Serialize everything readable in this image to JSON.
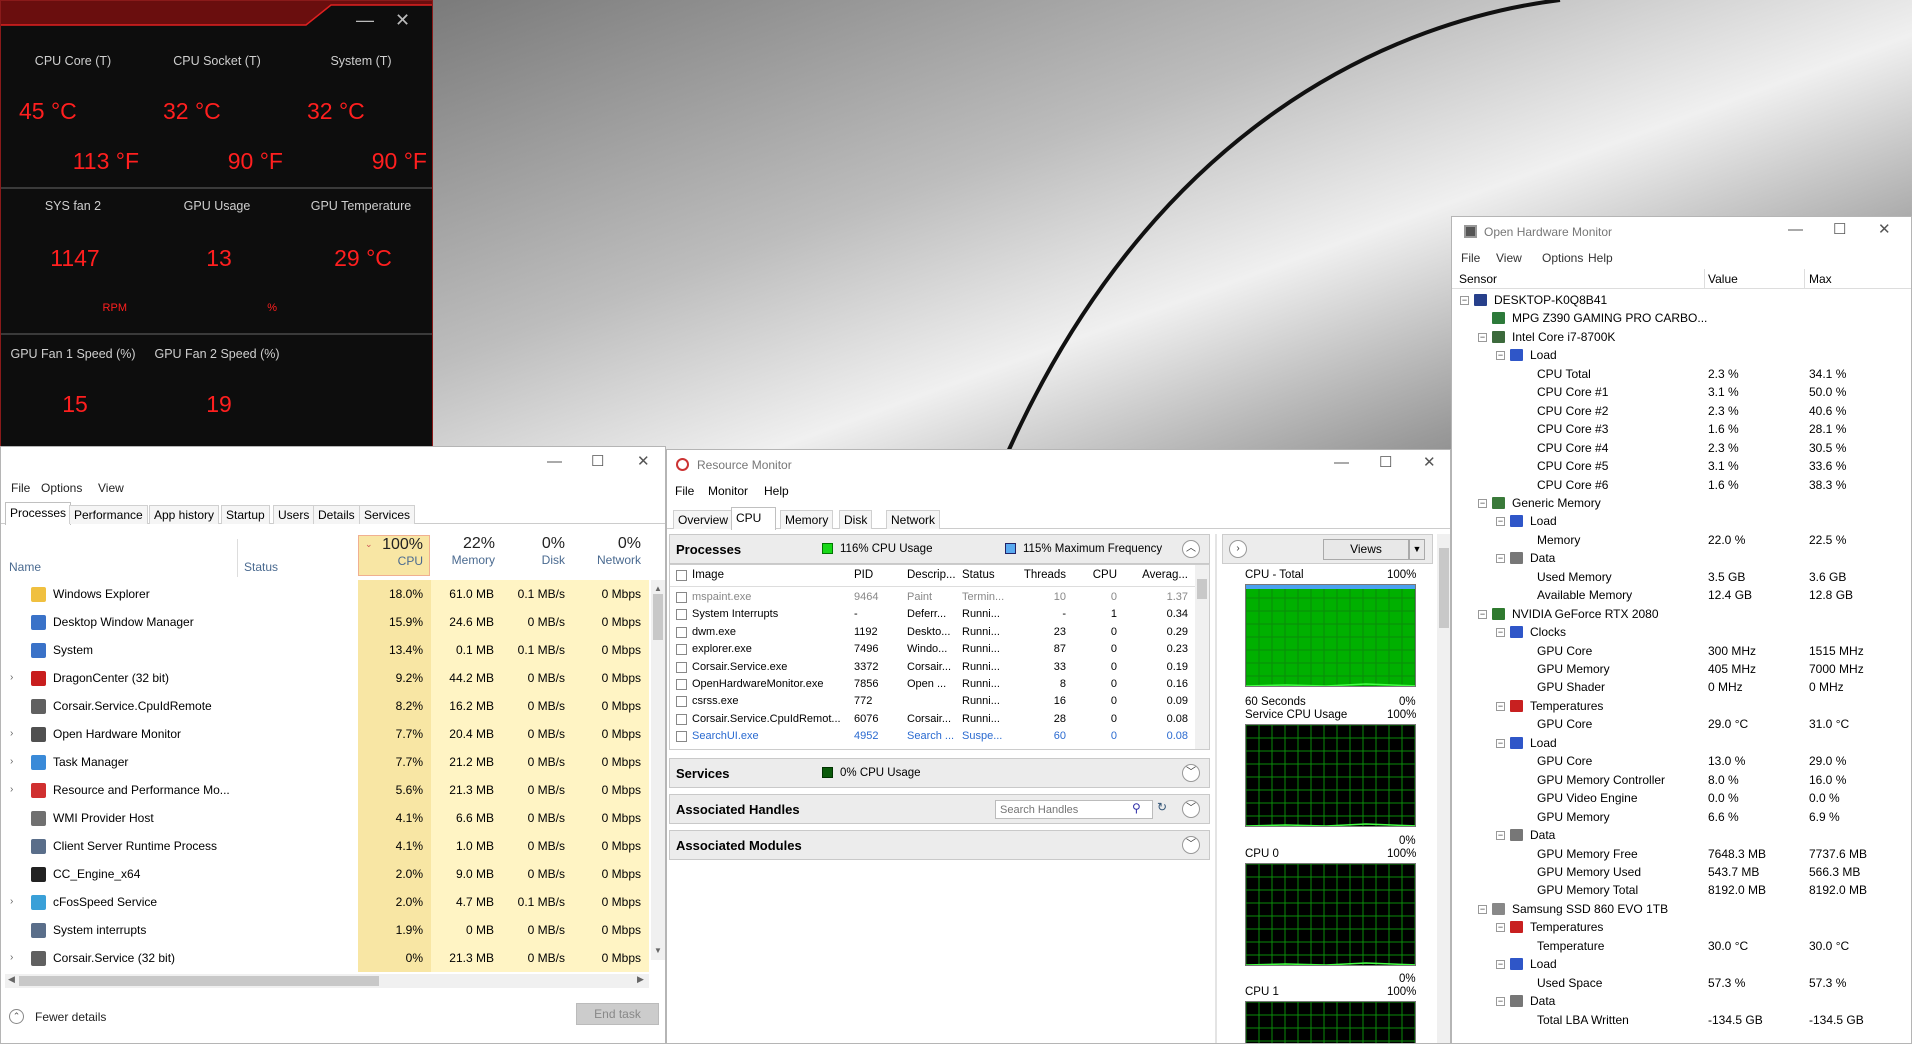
{
  "dragon": {
    "tiles": [
      {
        "label": "CPU Core (T)",
        "c": "45 °C",
        "f": "113 °F"
      },
      {
        "label": "CPU Socket (T)",
        "c": "32 °C",
        "f": "90 °F"
      },
      {
        "label": "System (T)",
        "c": "32 °C",
        "f": "90 °F"
      }
    ],
    "tiles2": [
      {
        "label": "SYS fan 2",
        "value": "1147",
        "unit": "RPM"
      },
      {
        "label": "GPU Usage",
        "value": "13",
        "unit": "%"
      },
      {
        "label": "GPU Temperature",
        "value": "29 °C",
        "unit": ""
      }
    ],
    "tiles3": [
      {
        "label": "GPU Fan 1 Speed (%)",
        "value": "15",
        "unit": "%"
      },
      {
        "label": "GPU Fan 2 Speed (%)",
        "value": "19",
        "unit": "%"
      }
    ]
  },
  "taskmgr": {
    "menu": [
      "File",
      "Options",
      "View"
    ],
    "tabs": [
      "Processes",
      "Performance",
      "App history",
      "Startup",
      "Users",
      "Details",
      "Services"
    ],
    "cols": {
      "name": "Name",
      "status": "Status",
      "cpu_pct": "100%",
      "cpu": "CPU",
      "mem_pct": "22%",
      "mem": "Memory",
      "disk_pct": "0%",
      "disk": "Disk",
      "net_pct": "0%",
      "net": "Network"
    },
    "rows": [
      {
        "name": "Windows Explorer",
        "cpu": "18.0%",
        "mem": "61.0 MB",
        "disk": "0.1 MB/s",
        "net": "0 Mbps",
        "exp": ""
      },
      {
        "name": "Desktop Window Manager",
        "cpu": "15.9%",
        "mem": "24.6 MB",
        "disk": "0 MB/s",
        "net": "0 Mbps",
        "exp": ""
      },
      {
        "name": "System",
        "cpu": "13.4%",
        "mem": "0.1 MB",
        "disk": "0.1 MB/s",
        "net": "0 Mbps",
        "exp": ""
      },
      {
        "name": "DragonCenter (32 bit)",
        "cpu": "9.2%",
        "mem": "44.2 MB",
        "disk": "0 MB/s",
        "net": "0 Mbps",
        "exp": ">"
      },
      {
        "name": "Corsair.Service.CpuIdRemote",
        "cpu": "8.2%",
        "mem": "16.2 MB",
        "disk": "0 MB/s",
        "net": "0 Mbps",
        "exp": ""
      },
      {
        "name": "Open Hardware Monitor",
        "cpu": "7.7%",
        "mem": "20.4 MB",
        "disk": "0 MB/s",
        "net": "0 Mbps",
        "exp": ">"
      },
      {
        "name": "Task Manager",
        "cpu": "7.7%",
        "mem": "21.2 MB",
        "disk": "0 MB/s",
        "net": "0 Mbps",
        "exp": ">"
      },
      {
        "name": "Resource and Performance Mo...",
        "cpu": "5.6%",
        "mem": "21.3 MB",
        "disk": "0 MB/s",
        "net": "0 Mbps",
        "exp": ">"
      },
      {
        "name": "WMI Provider Host",
        "cpu": "4.1%",
        "mem": "6.6 MB",
        "disk": "0 MB/s",
        "net": "0 Mbps",
        "exp": ""
      },
      {
        "name": "Client Server Runtime Process",
        "cpu": "4.1%",
        "mem": "1.0 MB",
        "disk": "0 MB/s",
        "net": "0 Mbps",
        "exp": ""
      },
      {
        "name": "CC_Engine_x64",
        "cpu": "2.0%",
        "mem": "9.0 MB",
        "disk": "0 MB/s",
        "net": "0 Mbps",
        "exp": ""
      },
      {
        "name": "cFosSpeed Service",
        "cpu": "2.0%",
        "mem": "4.7 MB",
        "disk": "0.1 MB/s",
        "net": "0 Mbps",
        "exp": ">"
      },
      {
        "name": "System interrupts",
        "cpu": "1.9%",
        "mem": "0 MB",
        "disk": "0 MB/s",
        "net": "0 Mbps",
        "exp": ""
      },
      {
        "name": "Corsair.Service (32 bit)",
        "cpu": "0%",
        "mem": "21.3 MB",
        "disk": "0 MB/s",
        "net": "0 Mbps",
        "exp": ">"
      }
    ],
    "fewer": "Fewer details",
    "end": "End task"
  },
  "resmon": {
    "title": "Resource Monitor",
    "menu": [
      "File",
      "Monitor",
      "Help"
    ],
    "tabs": [
      "Overview",
      "CPU",
      "Memory",
      "Disk",
      "Network"
    ],
    "processes": "Processes",
    "cpu_usage": "116% CPU Usage",
    "max_freq": "115% Maximum Frequency",
    "cols": [
      "Image",
      "PID",
      "Descrip...",
      "Status",
      "Threads",
      "CPU",
      "Averag..."
    ],
    "rows": [
      [
        "mspaint.exe",
        "9464",
        "Paint",
        "Termin...",
        "10",
        "0",
        "1.37"
      ],
      [
        "System Interrupts",
        "-",
        "Deferr...",
        "Runni...",
        "-",
        "1",
        "0.34"
      ],
      [
        "dwm.exe",
        "1192",
        "Deskto...",
        "Runni...",
        "23",
        "0",
        "0.29"
      ],
      [
        "explorer.exe",
        "7496",
        "Windo...",
        "Runni...",
        "87",
        "0",
        "0.23"
      ],
      [
        "Corsair.Service.exe",
        "3372",
        "Corsair...",
        "Runni...",
        "33",
        "0",
        "0.19"
      ],
      [
        "OpenHardwareMonitor.exe",
        "7856",
        "Open ...",
        "Runni...",
        "8",
        "0",
        "0.16"
      ],
      [
        "csrss.exe",
        "772",
        "",
        "Runni...",
        "16",
        "0",
        "0.09"
      ],
      [
        "Corsair.Service.CpuIdRemot...",
        "6076",
        "Corsair...",
        "Runni...",
        "28",
        "0",
        "0.08"
      ],
      [
        "SearchUI.exe",
        "4952",
        "Search ...",
        "Suspe...",
        "60",
        "0",
        "0.08"
      ]
    ],
    "services": "Services",
    "services_usage": "0% CPU Usage",
    "handles": "Associated Handles",
    "search_placeholder": "Search Handles",
    "modules": "Associated Modules",
    "views": "Views",
    "graphs": [
      {
        "label": "CPU - Total",
        "max": "100%",
        "min": "",
        "foot": ""
      },
      {
        "label": "Service CPU Usage",
        "max": "100%",
        "min": "0%",
        "foot": "60 Seconds"
      },
      {
        "label": "CPU 0",
        "max": "100%",
        "min": "0%",
        "foot": ""
      },
      {
        "label": "CPU 1",
        "max": "100%",
        "min": "0%",
        "foot": ""
      }
    ]
  },
  "ohm": {
    "title": "Open Hardware Monitor",
    "menu": [
      "File",
      "View",
      "Options",
      "Help"
    ],
    "cols": [
      "Sensor",
      "Value",
      "Max"
    ],
    "rows": [
      {
        "n": "DESKTOP-K0Q8B41",
        "v": "",
        "m": "",
        "lvl": 0,
        "t": "-",
        "ic": "pc"
      },
      {
        "n": "MPG Z390 GAMING PRO CARBO...",
        "v": "",
        "m": "",
        "lvl": 1,
        "t": "",
        "ic": "mb"
      },
      {
        "n": "Intel Core i7-8700K",
        "v": "",
        "m": "",
        "lvl": 1,
        "t": "-",
        "ic": "cpu"
      },
      {
        "n": "Load",
        "v": "",
        "m": "",
        "lvl": 2,
        "t": "-",
        "ic": "load"
      },
      {
        "n": "CPU Total",
        "v": "2.3 %",
        "m": "34.1 %",
        "lvl": 3,
        "t": "",
        "ic": ""
      },
      {
        "n": "CPU Core #1",
        "v": "3.1 %",
        "m": "50.0 %",
        "lvl": 3,
        "t": "",
        "ic": ""
      },
      {
        "n": "CPU Core #2",
        "v": "2.3 %",
        "m": "40.6 %",
        "lvl": 3,
        "t": "",
        "ic": ""
      },
      {
        "n": "CPU Core #3",
        "v": "1.6 %",
        "m": "28.1 %",
        "lvl": 3,
        "t": "",
        "ic": ""
      },
      {
        "n": "CPU Core #4",
        "v": "2.3 %",
        "m": "30.5 %",
        "lvl": 3,
        "t": "",
        "ic": ""
      },
      {
        "n": "CPU Core #5",
        "v": "3.1 %",
        "m": "33.6 %",
        "lvl": 3,
        "t": "",
        "ic": ""
      },
      {
        "n": "CPU Core #6",
        "v": "1.6 %",
        "m": "38.3 %",
        "lvl": 3,
        "t": "",
        "ic": ""
      },
      {
        "n": "Generic Memory",
        "v": "",
        "m": "",
        "lvl": 1,
        "t": "-",
        "ic": "mem"
      },
      {
        "n": "Load",
        "v": "",
        "m": "",
        "lvl": 2,
        "t": "-",
        "ic": "load"
      },
      {
        "n": "Memory",
        "v": "22.0 %",
        "m": "22.5 %",
        "lvl": 3,
        "t": "",
        "ic": ""
      },
      {
        "n": "Data",
        "v": "",
        "m": "",
        "lvl": 2,
        "t": "-",
        "ic": "data"
      },
      {
        "n": "Used Memory",
        "v": "3.5 GB",
        "m": "3.6 GB",
        "lvl": 3,
        "t": "",
        "ic": ""
      },
      {
        "n": "Available Memory",
        "v": "12.4 GB",
        "m": "12.8 GB",
        "lvl": 3,
        "t": "",
        "ic": ""
      },
      {
        "n": "NVIDIA GeForce RTX 2080",
        "v": "",
        "m": "",
        "lvl": 1,
        "t": "-",
        "ic": "gpu"
      },
      {
        "n": "Clocks",
        "v": "",
        "m": "",
        "lvl": 2,
        "t": "-",
        "ic": "clock"
      },
      {
        "n": "GPU Core",
        "v": "300 MHz",
        "m": "1515 MHz",
        "lvl": 3,
        "t": "",
        "ic": ""
      },
      {
        "n": "GPU Memory",
        "v": "405 MHz",
        "m": "7000 MHz",
        "lvl": 3,
        "t": "",
        "ic": ""
      },
      {
        "n": "GPU Shader",
        "v": "0 MHz",
        "m": "0 MHz",
        "lvl": 3,
        "t": "",
        "ic": ""
      },
      {
        "n": "Temperatures",
        "v": "",
        "m": "",
        "lvl": 2,
        "t": "-",
        "ic": "temp"
      },
      {
        "n": "GPU Core",
        "v": "29.0 °C",
        "m": "31.0 °C",
        "lvl": 3,
        "t": "",
        "ic": ""
      },
      {
        "n": "Load",
        "v": "",
        "m": "",
        "lvl": 2,
        "t": "-",
        "ic": "load"
      },
      {
        "n": "GPU Core",
        "v": "13.0 %",
        "m": "29.0 %",
        "lvl": 3,
        "t": "",
        "ic": ""
      },
      {
        "n": "GPU Memory Controller",
        "v": "8.0 %",
        "m": "16.0 %",
        "lvl": 3,
        "t": "",
        "ic": ""
      },
      {
        "n": "GPU Video Engine",
        "v": "0.0 %",
        "m": "0.0 %",
        "lvl": 3,
        "t": "",
        "ic": ""
      },
      {
        "n": "GPU Memory",
        "v": "6.6 %",
        "m": "6.9 %",
        "lvl": 3,
        "t": "",
        "ic": ""
      },
      {
        "n": "Data",
        "v": "",
        "m": "",
        "lvl": 2,
        "t": "-",
        "ic": "data"
      },
      {
        "n": "GPU Memory Free",
        "v": "7648.3 MB",
        "m": "7737.6 MB",
        "lvl": 3,
        "t": "",
        "ic": ""
      },
      {
        "n": "GPU Memory Used",
        "v": "543.7 MB",
        "m": "566.3 MB",
        "lvl": 3,
        "t": "",
        "ic": ""
      },
      {
        "n": "GPU Memory Total",
        "v": "8192.0 MB",
        "m": "8192.0 MB",
        "lvl": 3,
        "t": "",
        "ic": ""
      },
      {
        "n": "Samsung SSD 860 EVO 1TB",
        "v": "",
        "m": "",
        "lvl": 1,
        "t": "-",
        "ic": "disk"
      },
      {
        "n": "Temperatures",
        "v": "",
        "m": "",
        "lvl": 2,
        "t": "-",
        "ic": "temp"
      },
      {
        "n": "Temperature",
        "v": "30.0 °C",
        "m": "30.0 °C",
        "lvl": 3,
        "t": "",
        "ic": ""
      },
      {
        "n": "Load",
        "v": "",
        "m": "",
        "lvl": 2,
        "t": "-",
        "ic": "load"
      },
      {
        "n": "Used Space",
        "v": "57.3 %",
        "m": "57.3 %",
        "lvl": 3,
        "t": "",
        "ic": ""
      },
      {
        "n": "Data",
        "v": "",
        "m": "",
        "lvl": 2,
        "t": "-",
        "ic": "data"
      },
      {
        "n": "Total LBA Written",
        "v": "-134.5 GB",
        "m": "-134.5 GB",
        "lvl": 3,
        "t": "",
        "ic": ""
      }
    ]
  },
  "colors": {
    "accent_red": "#ff1f1f",
    "cpu_col": "#f8e6a4",
    "graph_green": "#00c000",
    "ohm_load": "#2f56c8"
  }
}
